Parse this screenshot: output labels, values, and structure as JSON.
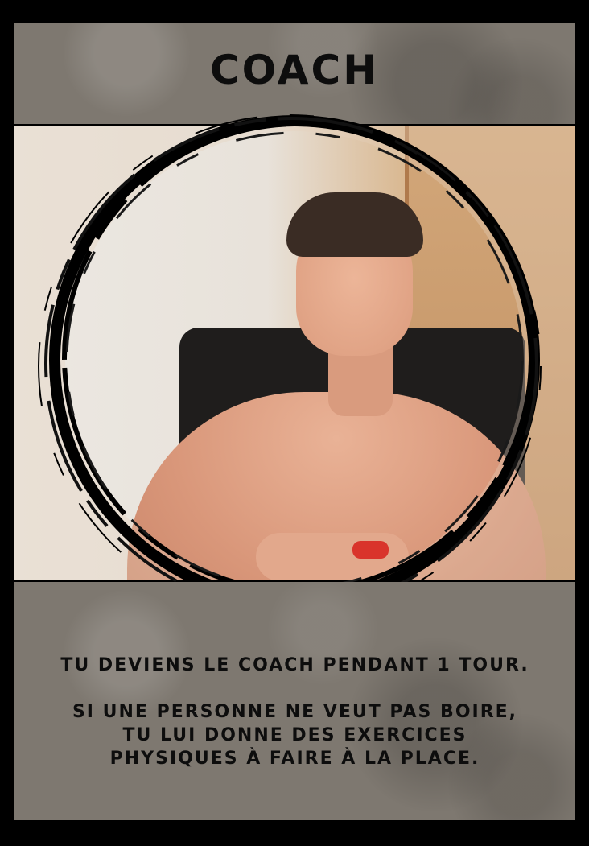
{
  "card": {
    "title": "COACH",
    "rule_line_1": "TU DEVIENS LE COACH PENDANT 1 TOUR.",
    "rule_line_2": "SI UNE PERSONNE NE VEUT PAS BOIRE,",
    "rule_line_3": "TU LUI DONNE DES EXERCICES",
    "rule_line_4": "PHYSIQUES À FAIRE À LA PLACE."
  },
  "colors": {
    "panel": "#7e7870",
    "text": "#0d0d0d",
    "frame": "#000000"
  }
}
